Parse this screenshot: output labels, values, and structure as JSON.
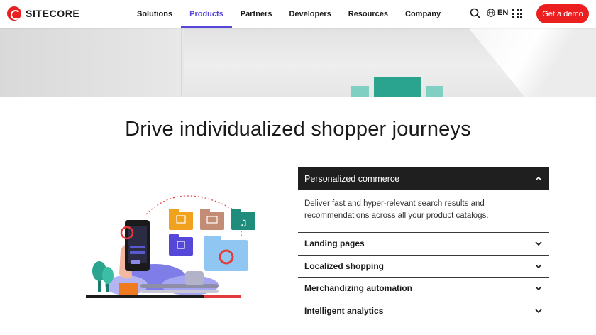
{
  "brand": {
    "name": "SITECORE",
    "accent": "#eb1f1f",
    "nav_accent": "#5548d9"
  },
  "nav": {
    "items": [
      {
        "label": "Solutions"
      },
      {
        "label": "Products"
      },
      {
        "label": "Partners"
      },
      {
        "label": "Developers"
      },
      {
        "label": "Resources"
      },
      {
        "label": "Company"
      }
    ],
    "active": "Products"
  },
  "header": {
    "search_icon": "search-icon",
    "language": "EN",
    "language_icon": "globe-icon",
    "apps_icon": "grid-icon",
    "cta_label": "Get a demo"
  },
  "main": {
    "heading": "Drive individualized shopper journeys"
  },
  "accordion": {
    "active": {
      "title": "Personalized commerce",
      "body": "Deliver fast and hyper-relevant search results and recommendations across all your product catalogs."
    },
    "items": [
      {
        "title": "Landing pages"
      },
      {
        "title": "Localized shopping"
      },
      {
        "title": "Merchandizing automation"
      },
      {
        "title": "Intelligent analytics"
      }
    ]
  }
}
